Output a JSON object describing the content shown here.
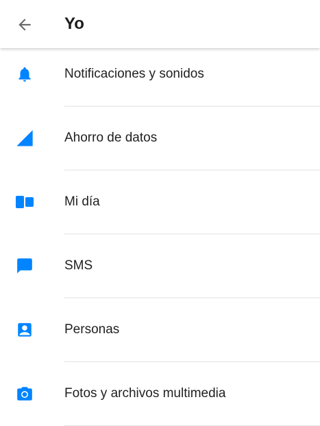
{
  "header": {
    "title": "Yo"
  },
  "colors": {
    "accent": "#0084ff",
    "back_arrow": "#6b6b6b",
    "divider": "#e3e3e3"
  },
  "items": [
    {
      "label": "Notificaciones y sonidos",
      "icon": "bell-icon"
    },
    {
      "label": "Ahorro de datos",
      "icon": "signal-triangle-icon"
    },
    {
      "label": "Mi día",
      "icon": "stories-icon"
    },
    {
      "label": "SMS",
      "icon": "chat-bubble-icon"
    },
    {
      "label": "Personas",
      "icon": "contact-card-icon"
    },
    {
      "label": "Fotos y archivos multimedia",
      "icon": "camera-icon"
    }
  ]
}
